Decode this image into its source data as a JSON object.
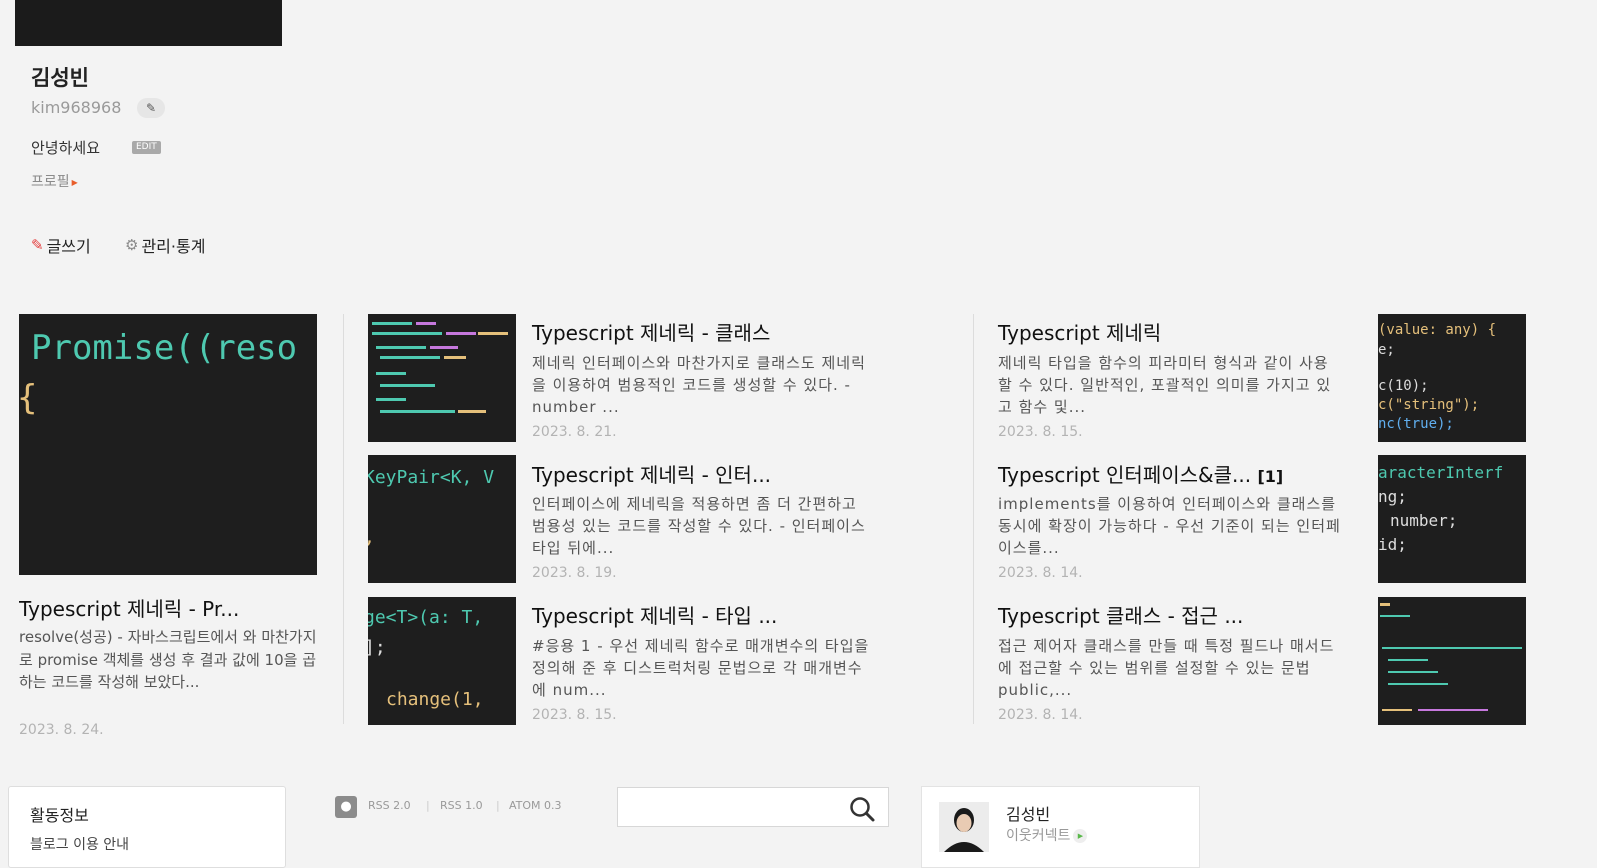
{
  "profile": {
    "name": "김성빈",
    "user_id": "kim968968",
    "greeting": "안녕하세요",
    "edit_badge": "EDIT",
    "profile_link": "프로필",
    "write_link": "글쓰기",
    "manage_link": "관리·통계"
  },
  "featured": {
    "thumb_code": "Promise((reso",
    "title": "Typescript 제네릭 - Pr...",
    "excerpt": "resolve(성공) - 자바스크립트에서 와 마찬가지로 promise 객체를 생성 후 결과 값에 10을 곱하는 코드를 작성해 보았다...",
    "date": "2023. 8. 24."
  },
  "posts": [
    {
      "title": "Typescript 제네릭 - 클래스",
      "excerpt": "제네릭 인터페이스와 마찬가지로 클래스도 제네릭을 이용하여 범용적인 코드를 생성할 수 있다. - number ...",
      "date": "2023. 8. 21."
    },
    {
      "title": "Typescript 제네릭",
      "excerpt": "제네릭 타입을 함수의 피라미터 형식과 같이 사용할 수 있다. 일반적인, 포괄적인 의미를 가지고 있고 함수 및...",
      "date": "2023. 8. 15."
    },
    {
      "title": "Typescript 제네릭 - 인터...",
      "excerpt": "인터페이스에 제네릭을 적용하면 좀 더 간편하고 범용성 있는 코드를 작성할 수 있다. - 인터페이스 타입 뒤에...",
      "date": "2023. 8. 19."
    },
    {
      "title": "Typescript 인터페이스&클...",
      "comments": "[1]",
      "excerpt": "implements를 이용하여 인터페이스와 클래스를 동시에 확장이 가능하다 - 우선 기준이 되는 인터페이스를...",
      "date": "2023. 8. 14."
    },
    {
      "title": "Typescript 제네릭 - 타입 ...",
      "excerpt": "#응용 1 - 우선 제네릭 함수로 매개변수의 타입을 정의해 준 후 디스트럭처링 문법으로 각 매개변수에 num...",
      "date": "2023. 8. 15."
    },
    {
      "title": "Typescript 클래스 - 접근 ...",
      "excerpt": "접근 제어자 클래스를 만들 때 특정 필드나 매서드에 접근할 수 있는 범위를 설정할 수 있는 문법 public,...",
      "date": "2023. 8. 14."
    }
  ],
  "thumbs": {
    "t3a": "KeyPair<K, V",
    "t5a": "ge<T>(a: T,",
    "t5b": "];",
    "t5c": "change(1,",
    "t2a": "(value: any) {",
    "t2b": "e;",
    "t2c": "c(10);",
    "t2d": "c(\"string\");",
    "t2e": "nc(true);",
    "t4a": "aracterInterf",
    "t4b": "ng;",
    "t4c": "number;",
    "t4d": "id;"
  },
  "footer": {
    "activity_title": "활동정보",
    "activity_sub": "블로그 이용 안내",
    "rss2": "RSS 2.0",
    "rss1": "RSS 1.0",
    "atom": "ATOM 0.3",
    "search_placeholder": "",
    "friend_name": "김성빈",
    "friend_connect": "이웃커넥트"
  }
}
